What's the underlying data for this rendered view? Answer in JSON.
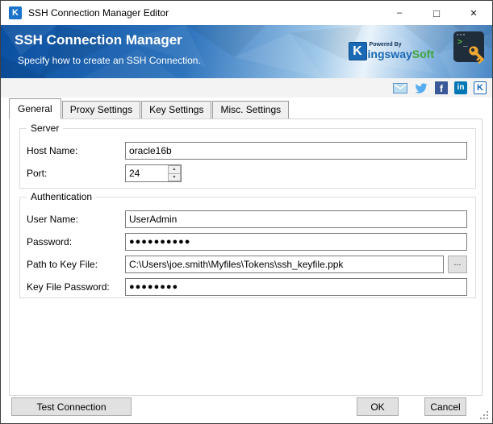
{
  "window": {
    "title": "SSH Connection Manager Editor",
    "app_icon_letter": "K",
    "minimize_glyph": "–",
    "maximize_glyph": "□",
    "close_glyph": "✕"
  },
  "header": {
    "title": "SSH Connection Manager",
    "subtitle": "Specify how to create an SSH Connection.",
    "logo": {
      "k_letter": "K",
      "powered_by": "Powered By",
      "name_part1": "ingsway",
      "name_part2": "Soft"
    },
    "terminal_icon": {
      "prompt": ">",
      "cursor": "_"
    }
  },
  "social": {
    "facebook_letter": "f",
    "linkedin_letters": "in",
    "kingsway_letter": "K",
    "icon_names": [
      "email-icon",
      "twitter-icon",
      "facebook-icon",
      "linkedin-icon",
      "kingswaysoft-icon"
    ]
  },
  "tabs": [
    {
      "label": "General",
      "active": true
    },
    {
      "label": "Proxy Settings",
      "active": false
    },
    {
      "label": "Key Settings",
      "active": false
    },
    {
      "label": "Misc. Settings",
      "active": false
    }
  ],
  "form": {
    "server": {
      "legend": "Server",
      "host_name_label": "Host Name:",
      "host_name_value": "oracle16b",
      "port_label": "Port:",
      "port_value": "24",
      "spinner_up": "▲",
      "spinner_down": "▼"
    },
    "authentication": {
      "legend": "Authentication",
      "user_name_label": "User Name:",
      "user_name_value": "UserAdmin",
      "password_label": "Password:",
      "password_value": "●●●●●●●●●●",
      "key_file_label": "Path to Key File:",
      "key_file_value": "C:\\Users\\joe.smith\\Myfiles\\Tokens\\ssh_keyfile.ppk",
      "browse_label": "...",
      "key_file_password_label": "Key File Password:",
      "key_file_password_value": "●●●●●●●●"
    }
  },
  "footer": {
    "test_connection_label": "Test Connection",
    "ok_label": "OK",
    "cancel_label": "Cancel"
  },
  "colors": {
    "accent_blue": "#1a69b5",
    "logo_green": "#3fa53c",
    "header_dark_blue": "#0a4fa0",
    "facebook_blue": "#3b5998",
    "linkedin_blue": "#0077b5",
    "twitter_blue": "#55acee",
    "key_gold": "#f0a830"
  }
}
